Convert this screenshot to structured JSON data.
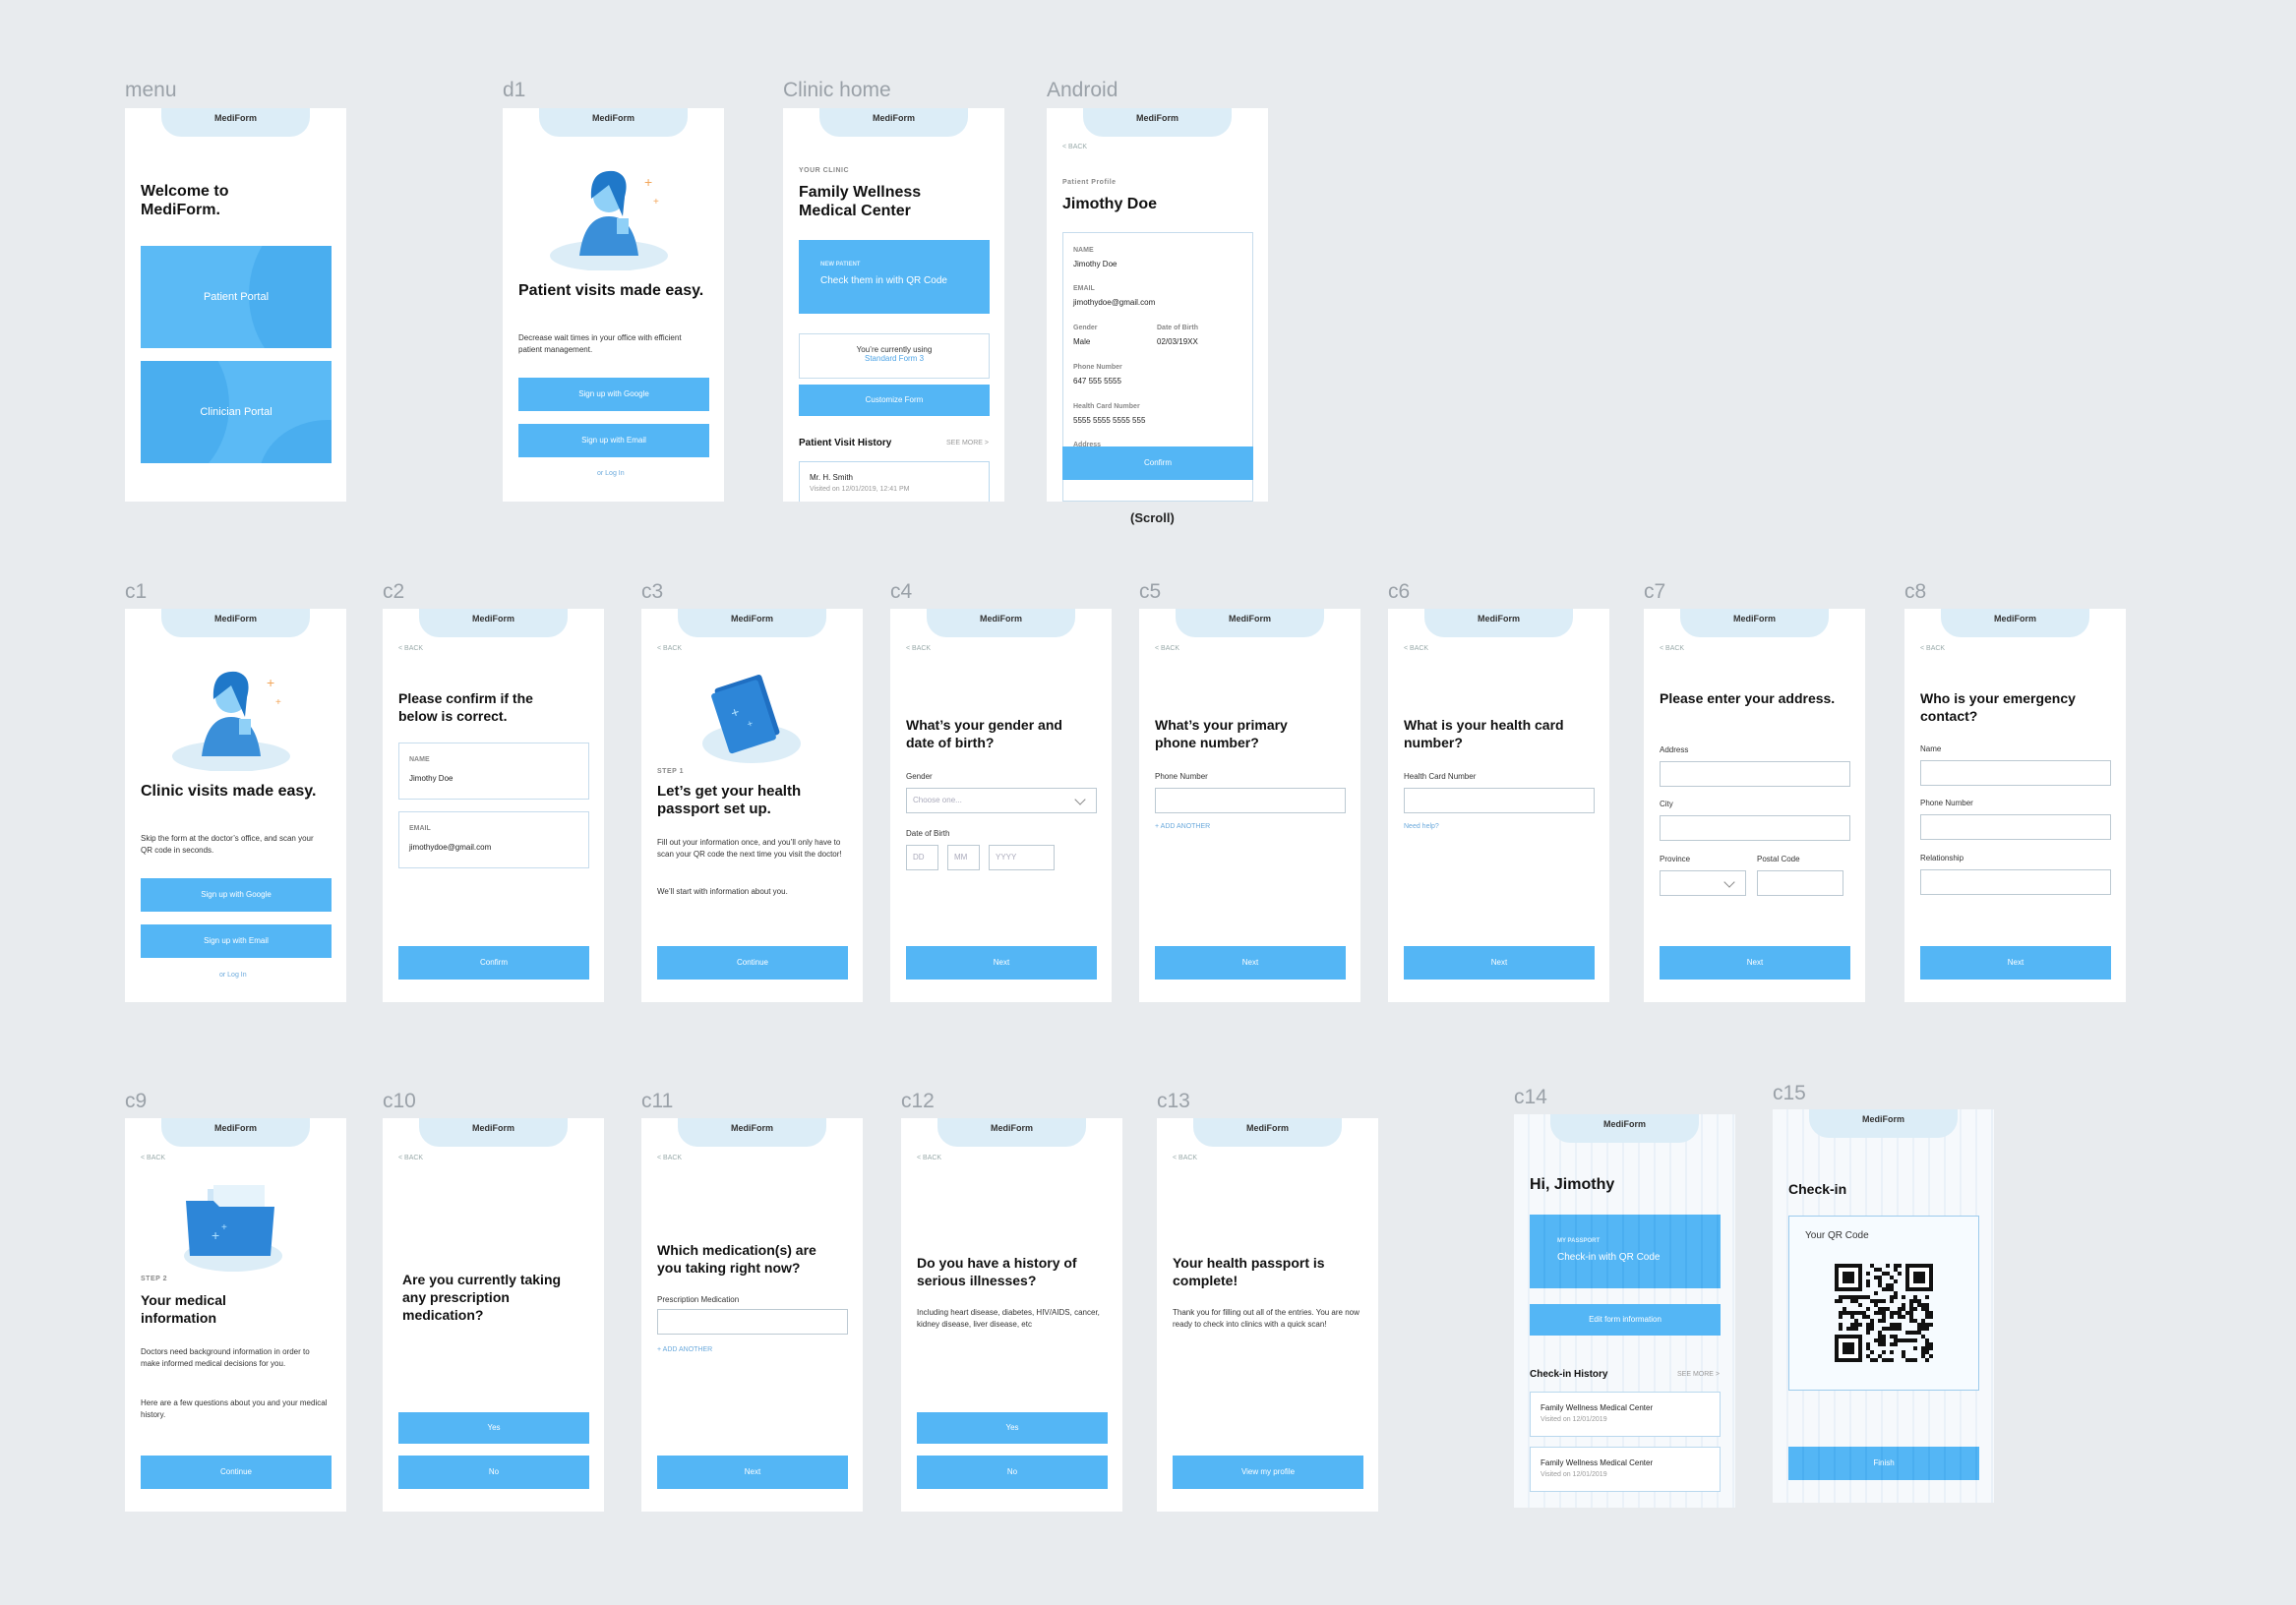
{
  "app_name": "MediForm",
  "back": "< BACK",
  "frames": {
    "menu": {
      "label": "menu",
      "title": "Welcome to MediForm.",
      "patient_portal": "Patient Portal",
      "clinician_portal": "Clinician Portal"
    },
    "d1": {
      "label": "d1",
      "title": "Patient visits made easy.",
      "desc": "Decrease wait times in your office with efficient patient management.",
      "google": "Sign up with Google",
      "email": "Sign up with Email",
      "login": "or Log In"
    },
    "clinic": {
      "label": "Clinic home",
      "eyebrow": "YOUR CLINIC",
      "title": "Family Wellness Medical Center",
      "np_eyebrow": "NEW PATIENT",
      "np_text": "Check them in with QR Code",
      "using": "You’re currently using",
      "form": "Standard Form 3",
      "customize": "Customize Form",
      "history": "Patient Visit History",
      "see_more": "SEE MORE >",
      "visit_name": "Mr. H. Smith",
      "visit_time": "Visited on 12/01/2019, 12:41 PM"
    },
    "android": {
      "label": "Android",
      "eyebrow": "Patient Profile",
      "title": "Jimothy Doe",
      "name_l": "NAME",
      "name_v": "Jimothy Doe",
      "email_l": "EMAIL",
      "email_v": "jimothydoe@gmail.com",
      "gender_l": "Gender",
      "gender_v": "Male",
      "dob_l": "Date of Birth",
      "dob_v": "02/03/19XX",
      "phone_l": "Phone Number",
      "phone_v": "647 555 5555",
      "hc_l": "Health Card Number",
      "hc_v": "5555 5555 5555 555",
      "addr_l": "Address",
      "confirm": "Confirm",
      "scroll": "(Scroll)"
    },
    "c1": {
      "label": "c1",
      "title": "Clinic visits made easy.",
      "desc": "Skip the form at the doctor’s office, and scan your QR code in seconds.",
      "google": "Sign up with Google",
      "email": "Sign up with Email",
      "login": "or Log In"
    },
    "c2": {
      "label": "c2",
      "title": "Please confirm if the below is correct.",
      "name_l": "NAME",
      "name_v": "Jimothy Doe",
      "email_l": "EMAIL",
      "email_v": "jimothydoe@gmail.com",
      "btn": "Confirm"
    },
    "c3": {
      "label": "c3",
      "step": "STEP 1",
      "title": "Let’s get your health passport set up.",
      "desc": "Fill out your information once, and you’ll only have to scan your QR code the next time you visit the doctor!",
      "desc2": "We’ll start with information about you.",
      "btn": "Continue"
    },
    "c4": {
      "label": "c4",
      "title": "What’s your gender and date of birth?",
      "gender_l": "Gender",
      "gender_ph": "Choose one...",
      "dob_l": "Date of Birth",
      "dd": "DD",
      "mm": "MM",
      "yyyy": "YYYY",
      "btn": "Next"
    },
    "c5": {
      "label": "c5",
      "title": "What’s your primary phone number?",
      "phone_l": "Phone Number",
      "add": "+ ADD ANOTHER",
      "btn": "Next"
    },
    "c6": {
      "label": "c6",
      "title": "What is your health card number?",
      "hc_l": "Health Card Number",
      "help": "Need help?",
      "btn": "Next"
    },
    "c7": {
      "label": "c7",
      "title": "Please enter your address.",
      "addr_l": "Address",
      "city_l": "City",
      "prov_l": "Province",
      "postal_l": "Postal Code",
      "btn": "Next"
    },
    "c8": {
      "label": "c8",
      "title": "Who is your emergency contact?",
      "name_l": "Name",
      "phone_l": "Phone Number",
      "rel_l": "Relationship",
      "btn": "Next"
    },
    "c9": {
      "label": "c9",
      "step": "STEP 2",
      "title": "Your medical information",
      "desc": "Doctors need background information in order to make informed medical decisions for you.",
      "desc2": "Here are a few questions about you and your medical history.",
      "btn": "Continue"
    },
    "c10": {
      "label": "c10",
      "title": "Are you currently taking any prescription medication?",
      "yes": "Yes",
      "no": "No"
    },
    "c11": {
      "label": "c11",
      "title": "Which medication(s) are you taking right now?",
      "med_l": "Prescription Medication",
      "add": "+ ADD ANOTHER",
      "btn": "Next"
    },
    "c12": {
      "label": "c12",
      "title": "Do you have a history of serious illnesses?",
      "desc": "Including heart disease, diabetes, HIV/AIDS, cancer, kidney disease, liver disease, etc",
      "yes": "Yes",
      "no": "No"
    },
    "c13": {
      "label": "c13",
      "title": "Your health passport is complete!",
      "desc": "Thank you for filling out all of the entries. You are now ready to check into clinics with a quick scan!",
      "btn": "View my profile"
    },
    "c14": {
      "label": "c14",
      "title": "Hi, Jimothy",
      "pp_eyebrow": "MY PASSPORT",
      "pp_text": "Check-in with QR Code",
      "edit": "Edit form information",
      "history": "Check-in History",
      "see_more": "SEE MORE >",
      "h1_t": "Family Wellness Medical Center",
      "h1_s": "Visited on 12/01/2019",
      "h2_t": "Family Wellness Medical Center",
      "h2_s": "Visited on 12/01/2019"
    },
    "c15": {
      "label": "c15",
      "title": "Check-in",
      "qr_title": "Your QR Code",
      "btn": "Finish"
    }
  },
  "colors": {
    "primary": "#54b6f5",
    "pill": "#dcedf7",
    "background": "#e8ebee"
  }
}
